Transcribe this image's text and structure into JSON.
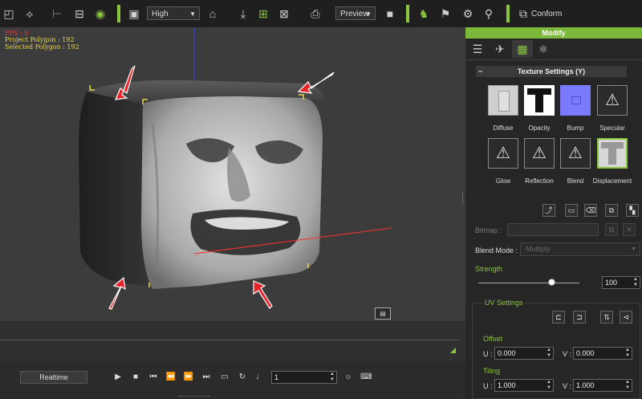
{
  "toolbar": {
    "quality_value": "High",
    "preview_value": "Preview",
    "conform_label": "Conform"
  },
  "viewport": {
    "fps": "FPS : 0",
    "project_polygon": "Project Polygon : 192",
    "selected_polygon": "Selected Polygon : 192"
  },
  "panel": {
    "title": "Modify",
    "section_title": "Texture Settings  (Y)",
    "channels": [
      "Diffuse",
      "Opacity",
      "Bump",
      "Specular",
      "Glow",
      "Reflection",
      "Blend",
      "Displacement"
    ],
    "bitmap_label": "Bitmap :",
    "blend_mode_label": "Blend Mode :",
    "blend_mode_value": "Multiply",
    "strength_label": "Strength",
    "strength_value": "100",
    "strength_fraction": 0.72,
    "uv_settings_label": "UV Settings",
    "offset_label": "Offset",
    "offset_u_label": "U :",
    "offset_u_value": "0.000",
    "offset_v_label": "V :",
    "offset_v_value": "0.000",
    "tiling_label": "Tiling",
    "tiling_u_label": "U :",
    "tiling_u_value": "1.000",
    "tiling_v_label": "V :",
    "tiling_v_value": "1.000"
  },
  "transport": {
    "realtime_label": "Realtime",
    "frame_value": "1"
  },
  "colors": {
    "accent": "#8cc63f",
    "arrow": "#e8242a",
    "hud_red": "#ff3030",
    "hud_yellow": "#e8d84a"
  }
}
